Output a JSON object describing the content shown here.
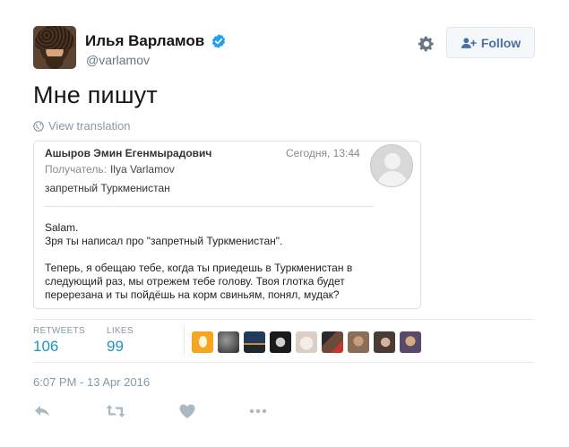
{
  "author": {
    "name": "Илья Варламов",
    "handle": "@varlamov",
    "verified_color": "#1da1f2"
  },
  "actions_top": {
    "settings_icon": "gear-icon",
    "follow_label": "Follow",
    "follow_icon": "add-user-icon"
  },
  "tweet": {
    "text": "Мне пишут",
    "translate_label": "View translation",
    "translate_icon": "globe-icon"
  },
  "email": {
    "from": "Ашыров Эмин Егенмырадович",
    "date": "Сегодня, 13:44",
    "to_label": "Получатель:",
    "to_value": "Ilya Varlamov",
    "subject": "запретный Туркменистан",
    "body_line1": "Salam.",
    "body_line2": "Зря ты написал про \"запретный Туркменистан\".",
    "body_paragraph": "Теперь, я обещаю тебе, когда ты приедешь в Туркменистан в следующий раз, мы отрежем тебе голову. Твоя глотка будет перерезана и ты пойдёшь на корм свиньям, понял, мудак?"
  },
  "stats": {
    "retweets_label": "RETWEETS",
    "retweets_value": "106",
    "likes_label": "LIKES",
    "likes_value": "99"
  },
  "likers": [
    {
      "name": "liker-avatar-1",
      "color": "#f5a623"
    },
    {
      "name": "liker-avatar-2",
      "color": "#555555"
    },
    {
      "name": "liker-avatar-3",
      "color": "#1f3a5a"
    },
    {
      "name": "liker-avatar-4",
      "color": "#1a1a1a"
    },
    {
      "name": "liker-avatar-5",
      "color": "#d9cfc4"
    },
    {
      "name": "liker-avatar-6",
      "color": "#6b4a3a"
    },
    {
      "name": "liker-avatar-7",
      "color": "#8a6e55"
    },
    {
      "name": "liker-avatar-8",
      "color": "#4a3b35"
    },
    {
      "name": "liker-avatar-9",
      "color": "#9a6b4f"
    }
  ],
  "timestamp": "6:07 PM - 13 Apr 2016",
  "bottom_actions": [
    "reply-icon",
    "retweet-icon",
    "like-icon",
    "more-icon"
  ],
  "colors": {
    "accent": "#1b95c2",
    "muted": "#8899a6",
    "action_gray": "#aab8c2"
  }
}
